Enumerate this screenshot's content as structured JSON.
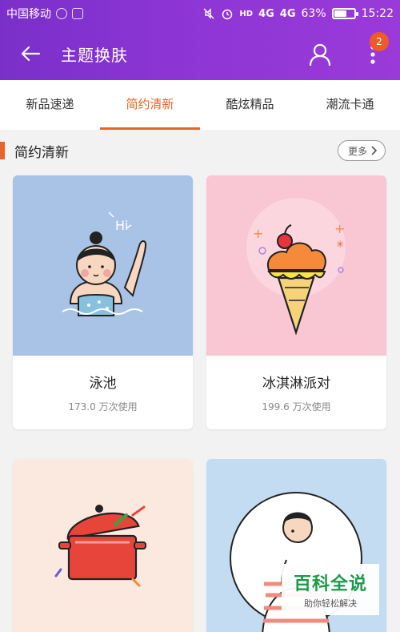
{
  "status": {
    "carrier": "中国移动",
    "hd": "HD",
    "net1": "4G",
    "net2": "4G",
    "battery": "63%",
    "time": "15:22"
  },
  "header": {
    "title": "主题换肤",
    "badge": "2",
    "accent": "#8a35d4"
  },
  "tabs": [
    {
      "label": "新品速递"
    },
    {
      "label": "简约清新",
      "active": true
    },
    {
      "label": "酷炫精品"
    },
    {
      "label": "潮流卡通"
    }
  ],
  "section": {
    "title": "简约清新",
    "more": "更多"
  },
  "themes": [
    {
      "name": "泳池",
      "uses": "173.0 万次使用",
      "bg": "#a9c3e6"
    },
    {
      "name": "冰淇淋派对",
      "uses": "199.6 万次使用",
      "bg": "#f9c7d4"
    },
    {
      "name": "",
      "uses": "",
      "bg": "#fbe8df"
    },
    {
      "name": "",
      "uses": "",
      "bg": "#c4dcf2"
    }
  ],
  "watermark": {
    "title": "百科全说",
    "subtitle": "助你轻松解决"
  }
}
